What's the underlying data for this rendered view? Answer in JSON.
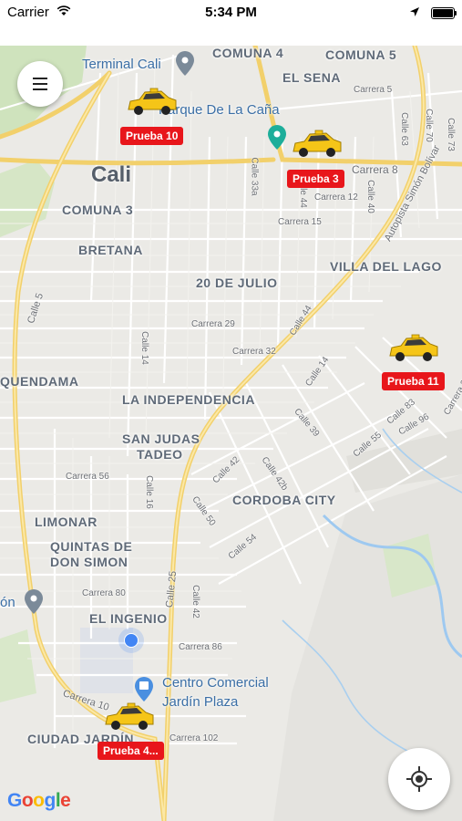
{
  "status_bar": {
    "carrier": "Carrier",
    "time": "5:34 PM"
  },
  "map": {
    "city": "Cali",
    "areas": [
      "COMUNA 4",
      "COMUNA 5",
      "EL SENA",
      "COMUNA 3",
      "BRETANA",
      "20 DE JULIO",
      "VILLA DEL LAGO",
      "QUENDAMA",
      "LA INDEPENDENCIA",
      "SAN JUDAS",
      "TADEO",
      "CORDOBA CITY",
      "LIMONAR",
      "QUINTAS DE",
      "DON SIMON",
      "EL INGENIO",
      "CIUDAD JARDÍN"
    ],
    "streets": [
      "Carrera 5",
      "Carrera 8",
      "Carrera 12",
      "Carrera 15",
      "Carrera 29",
      "Carrera 32",
      "Carrera 56",
      "Carrera 80",
      "Carrera 86",
      "Carrera 102",
      "Carrera 10",
      "Carrera 28",
      "Calle 5",
      "Calle 25",
      "Calle 33a",
      "Calle 44",
      "Calle 40",
      "Calle 63",
      "Calle 70",
      "Calle 73",
      "Calle 14",
      "Calle 16",
      "Calle 42",
      "Calle 42b",
      "Calle 39",
      "Calle 50",
      "Calle 54",
      "Calle 55",
      "Calle 83",
      "Calle 96",
      "Autopista Simón Bolívar"
    ],
    "pois": {
      "terminal": "Terminal Cali",
      "parque": "Parque De La Caña",
      "mall_line1": "Centro Comercial",
      "mall_line2": "Jardín Plaza",
      "left_pin_partial": "ón"
    }
  },
  "vehicles": [
    {
      "label": "Prueba 10"
    },
    {
      "label": "Prueba 3"
    },
    {
      "label": "Prueba 11"
    },
    {
      "label": "Prueba 4..."
    }
  ],
  "branding": {
    "google": [
      "G",
      "o",
      "o",
      "g",
      "l",
      "e"
    ]
  },
  "colors": {
    "tag": "#e8161b",
    "taxi": "#f5c518",
    "user_location": "#4285f4",
    "highway": "#f7d774"
  }
}
